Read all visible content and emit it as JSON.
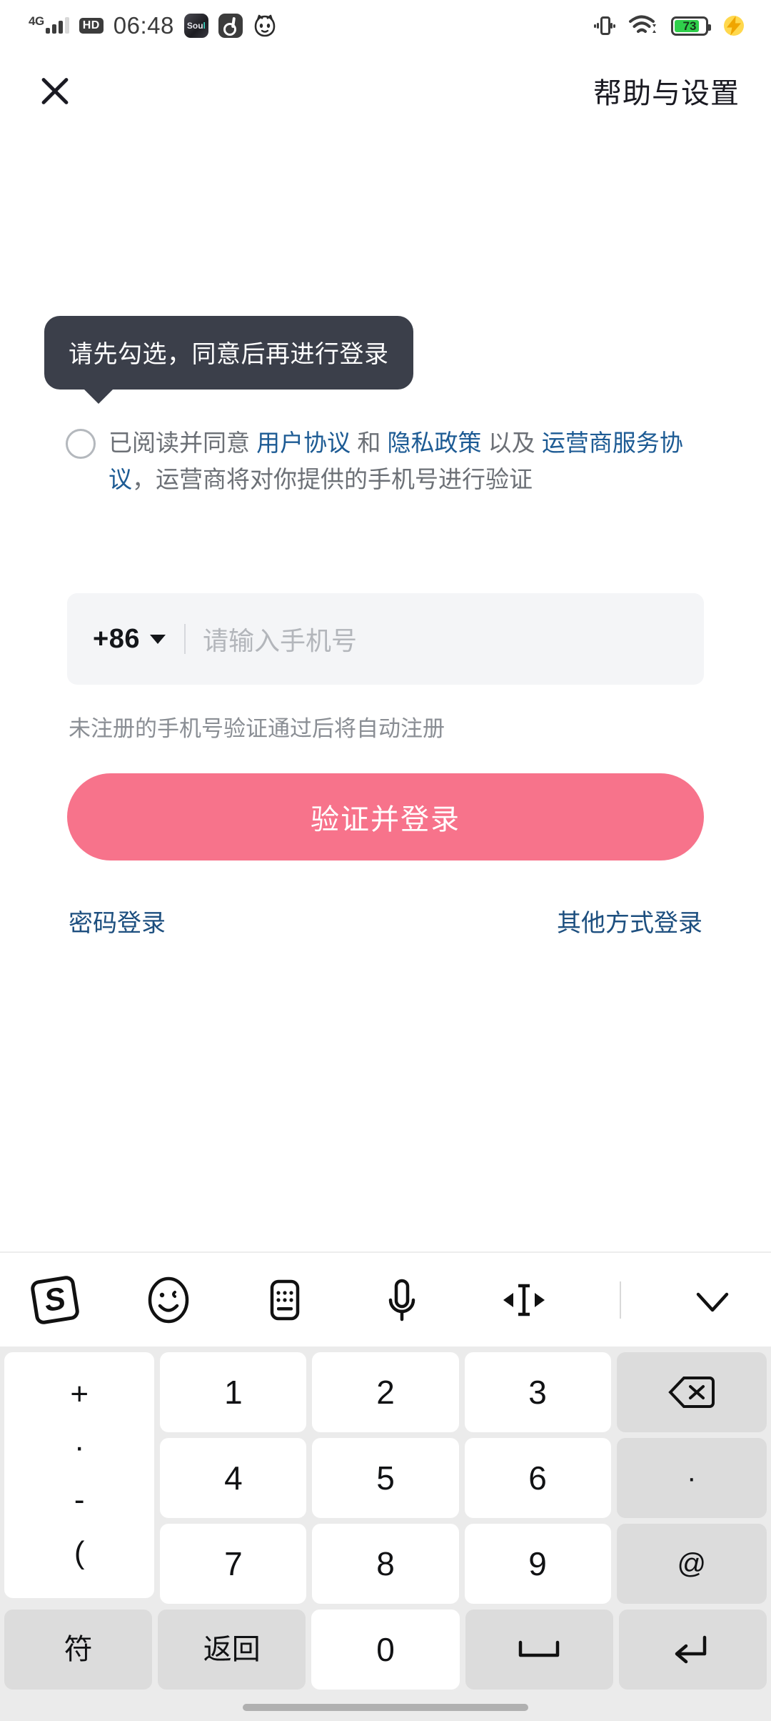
{
  "statusbar": {
    "network_type": "4G",
    "hd_badge": "HD",
    "time": "06:48",
    "app_icons": [
      "soul-app-icon",
      "douyin-app-icon",
      "cat-app-icon"
    ],
    "soul_label": "Sou",
    "soul_label_accent": "l",
    "battery_percent": "73",
    "right_icons": [
      "vibrate-icon",
      "wifi-icon",
      "battery-icon",
      "charging-bolt-icon"
    ]
  },
  "header": {
    "close_icon": "close-icon",
    "help_label": "帮助与设置"
  },
  "tooltip": {
    "message": "请先勾选，同意后再进行登录"
  },
  "agreement": {
    "checked": false,
    "prefix": "已阅读并同意 ",
    "link_user": "用户协议",
    "between_1": " 和 ",
    "link_privacy": "隐私政策",
    "between_2": " 以及 ",
    "link_operator": "运营商服务协议",
    "suffix": "，运营商将对你提供的手机号进行验证"
  },
  "phone": {
    "country_code": "+86",
    "placeholder": "请输入手机号",
    "value": ""
  },
  "hint": {
    "text": "未注册的手机号验证通过后将自动注册"
  },
  "login": {
    "label": "验证并登录",
    "color": "#f7738b"
  },
  "alt_login": {
    "password_label": "密码登录",
    "other_label": "其他方式登录",
    "link_color": "#1d4f7f"
  },
  "keyboard": {
    "toolbar": [
      {
        "name": "sogou-logo-icon",
        "glyph": "S"
      },
      {
        "name": "emoji-icon",
        "glyph": ""
      },
      {
        "name": "keyboard-switch-icon",
        "glyph": ""
      },
      {
        "name": "microphone-icon",
        "glyph": ""
      },
      {
        "name": "cursor-move-icon",
        "glyph": ""
      },
      {
        "name": "divider",
        "glyph": ""
      },
      {
        "name": "chevron-down-icon",
        "glyph": ""
      }
    ],
    "symbol_column": [
      "+",
      "·",
      "-",
      "("
    ],
    "numpad": [
      [
        "1",
        "2",
        "3"
      ],
      [
        "4",
        "5",
        "6"
      ],
      [
        "7",
        "8",
        "9"
      ]
    ],
    "right_column": [
      {
        "name": "backspace-key",
        "label": ""
      },
      {
        "name": "dot-key",
        "label": "·"
      },
      {
        "name": "at-key",
        "label": "@"
      },
      {
        "name": "enter-key",
        "label": ""
      }
    ],
    "bottom_row": [
      {
        "name": "symbols-key",
        "label": "符"
      },
      {
        "name": "return-key",
        "label": "返回"
      },
      {
        "name": "zero-key",
        "label": "0"
      },
      {
        "name": "space-key",
        "label": ""
      },
      {
        "name": "enter-key",
        "label": ""
      }
    ]
  }
}
